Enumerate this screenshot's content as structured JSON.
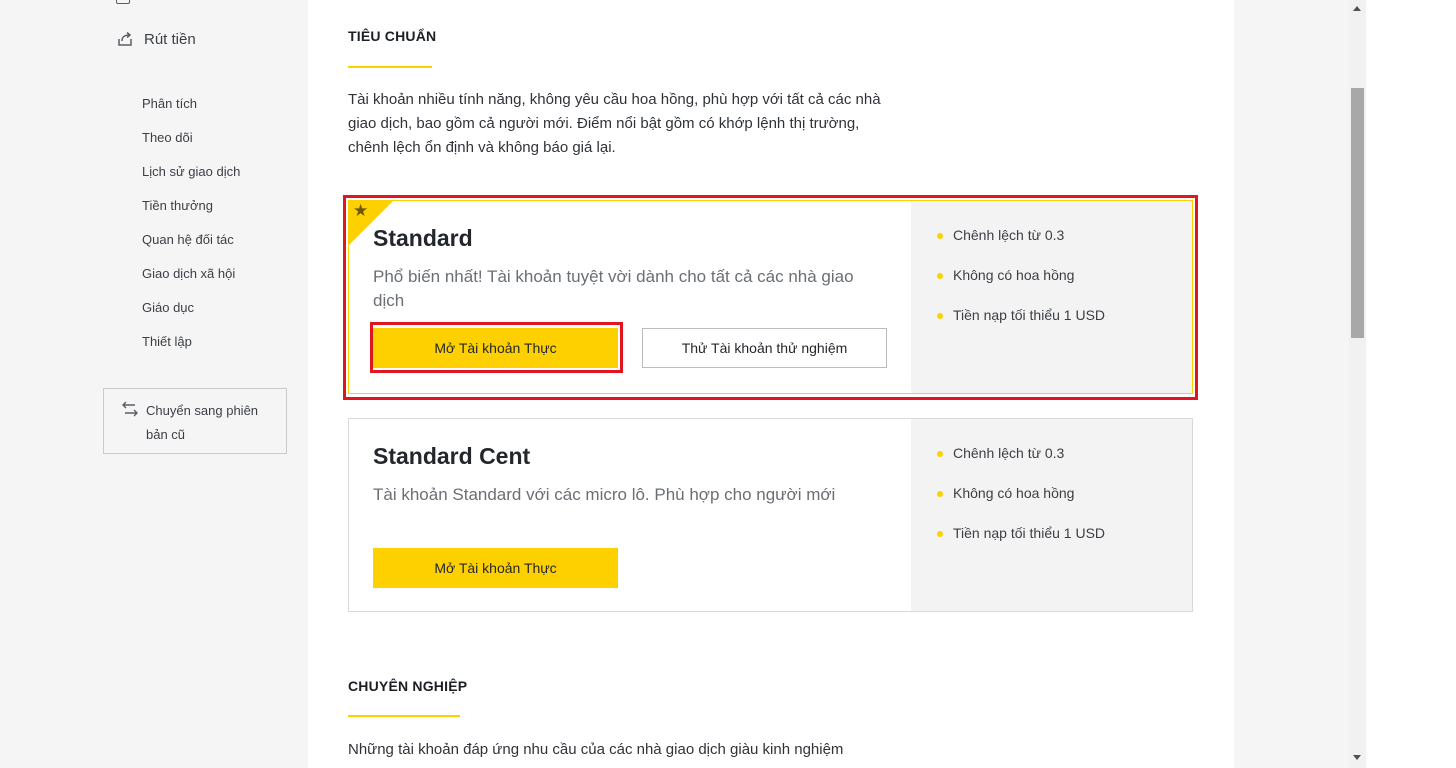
{
  "sidebar": {
    "withdraw_label": "Rút tiền",
    "items": [
      {
        "label": "Phân tích"
      },
      {
        "label": "Theo dõi"
      },
      {
        "label": "Lịch sử giao dịch"
      },
      {
        "label": "Tiền thưởng"
      },
      {
        "label": "Quan hệ đối tác"
      },
      {
        "label": "Giao dịch xã hội"
      },
      {
        "label": "Giáo dục"
      },
      {
        "label": "Thiết lập"
      }
    ],
    "switch_label": "Chuyển sang phiên bản cũ"
  },
  "standard_section": {
    "title": "TIÊU CHUẨN",
    "description": "Tài khoản nhiều tính năng, không yêu cầu hoa hồng, phù hợp với tất cả các nhà giao dịch, bao gồm cả người mới. Điểm nổi bật gồm có khớp lệnh thị trường, chênh lệch ổn định và không báo giá lại."
  },
  "accounts": [
    {
      "name": "Standard",
      "description": "Phổ biến nhất! Tài khoản tuyệt vời dành cho tất cả các nhà giao dịch",
      "real_button": "Mở Tài khoản Thực",
      "demo_button": "Thử Tài khoản thử nghiệm",
      "features": [
        "Chênh lệch từ 0.3",
        "Không có hoa hồng",
        "Tiền nạp tối thiểu 1 USD"
      ]
    },
    {
      "name": "Standard Cent",
      "description": "Tài khoản Standard với các micro lô. Phù hợp cho người mới",
      "real_button": "Mở Tài khoản Thực",
      "features": [
        "Chênh lệch từ 0.3",
        "Không có hoa hồng",
        "Tiền nạp tối thiểu 1 USD"
      ]
    }
  ],
  "pro_section": {
    "title": "CHUYÊN NGHIỆP",
    "description": "Những tài khoản đáp ứng nhu cầu của các nhà giao dịch giàu kinh nghiệm"
  },
  "colors": {
    "accent": "#ffd000",
    "highlight": "#e0151f"
  }
}
